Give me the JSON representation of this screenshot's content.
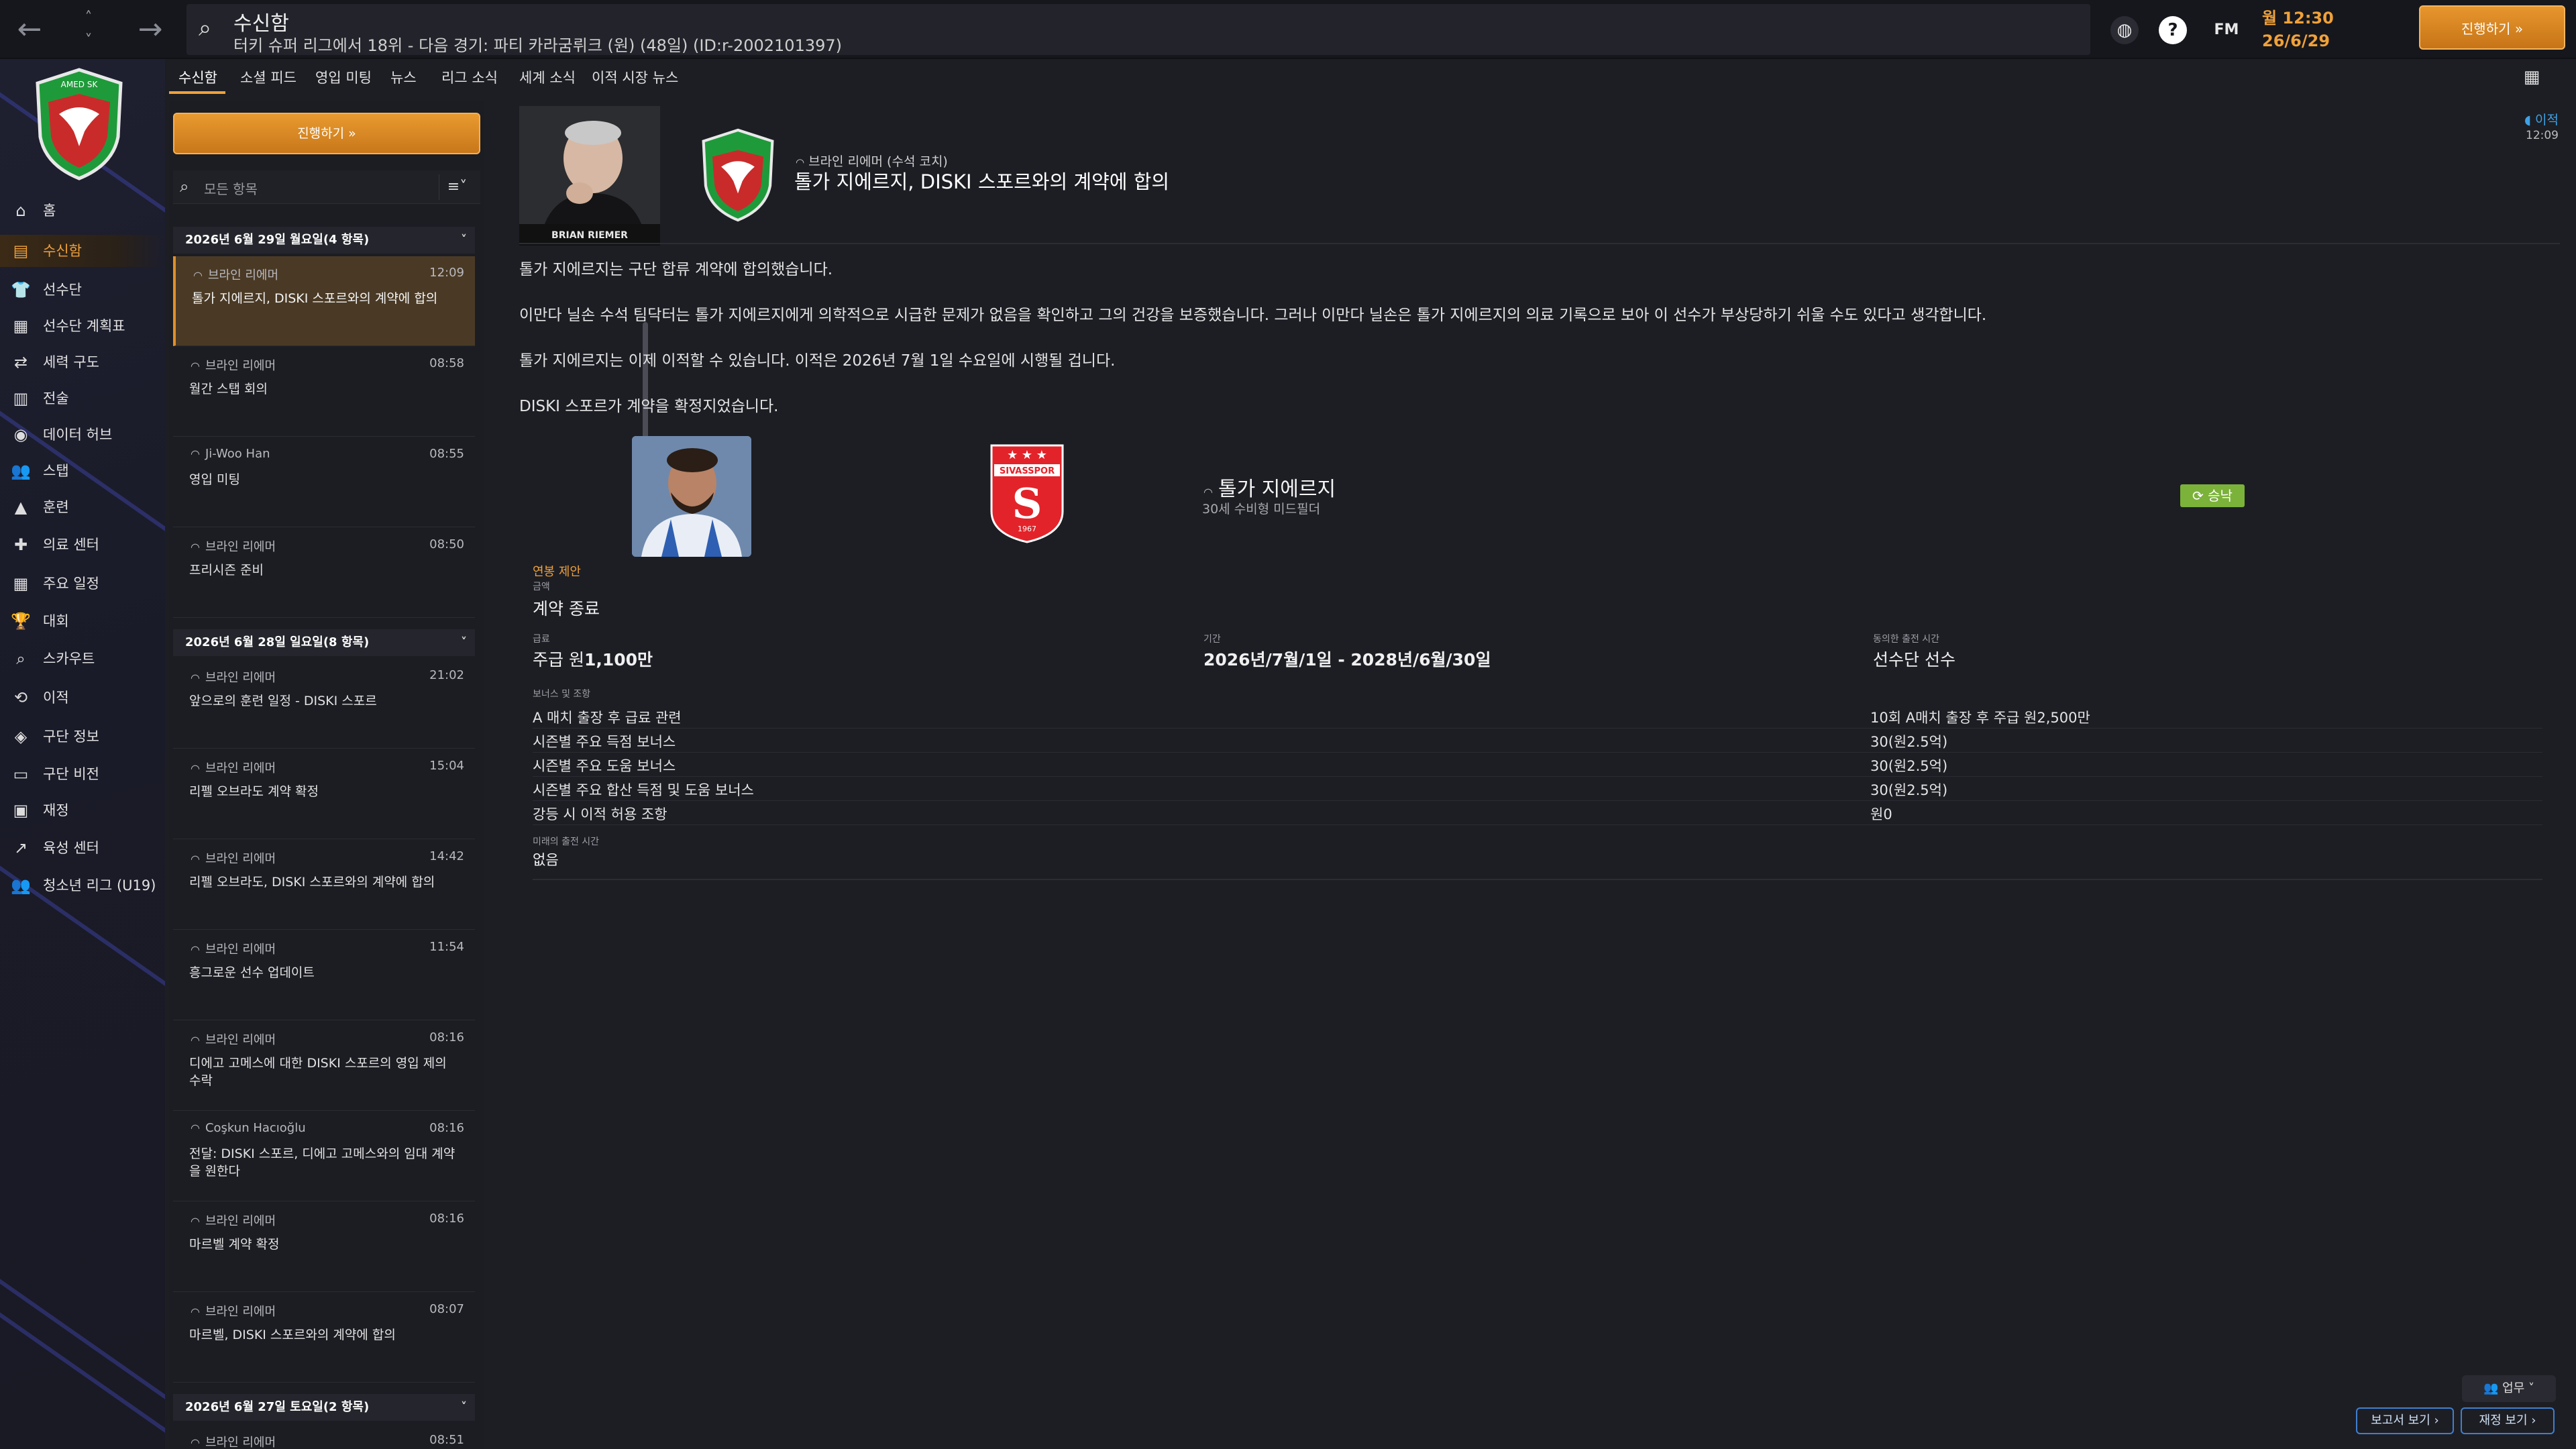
{
  "header": {
    "title": "수신함",
    "subtitle": "터키 슈퍼 리그에서 18위 - 다음 경기: 파티 카라굼뤼크 (원) (48일) (ID:r-2002101397)",
    "time": "월 12:30",
    "date": "26/6/29",
    "continue_label": "진행하기 »",
    "fm_label": "FM",
    "help_label": "?"
  },
  "sidebar": {
    "club_name": "AMED SK",
    "items": [
      {
        "label": "홈",
        "icon": "home-icon",
        "glyph": "⌂"
      },
      {
        "label": "수신함",
        "icon": "inbox-icon",
        "glyph": "▤"
      },
      {
        "label": "선수단",
        "icon": "squad-icon",
        "glyph": "👕"
      },
      {
        "label": "선수단 계획표",
        "icon": "squad-planner-icon",
        "glyph": "▦"
      },
      {
        "label": "세력 구도",
        "icon": "dynamics-icon",
        "glyph": "⇄"
      },
      {
        "label": "전술",
        "icon": "tactics-icon",
        "glyph": "▥"
      },
      {
        "label": "데이터 허브",
        "icon": "data-hub-icon",
        "glyph": "◉"
      },
      {
        "label": "스탭",
        "icon": "staff-icon",
        "glyph": "👥"
      },
      {
        "label": "훈련",
        "icon": "training-icon",
        "glyph": "▲"
      },
      {
        "label": "의료 센터",
        "icon": "medical-icon",
        "glyph": "✚"
      },
      {
        "label": "주요 일정",
        "icon": "schedule-icon",
        "glyph": "▦"
      },
      {
        "label": "대회",
        "icon": "competitions-icon",
        "glyph": "🏆"
      },
      {
        "label": "스카우트",
        "icon": "scouting-icon",
        "glyph": "⌕"
      },
      {
        "label": "이적",
        "icon": "transfers-icon",
        "glyph": "⟲"
      },
      {
        "label": "구단 정보",
        "icon": "club-info-icon",
        "glyph": "◈"
      },
      {
        "label": "구단 비전",
        "icon": "club-vision-icon",
        "glyph": "▭"
      },
      {
        "label": "재정",
        "icon": "finances-icon",
        "glyph": "▣"
      },
      {
        "label": "육성 센터",
        "icon": "development-icon",
        "glyph": "↗"
      },
      {
        "label": "청소년 리그 (U19)",
        "icon": "youth-league-icon",
        "glyph": "👥"
      }
    ]
  },
  "tabs": [
    "수신함",
    "소셜 피드",
    "영입 미팅",
    "뉴스",
    "리그 소식",
    "세계 소식",
    "이적 시장 뉴스"
  ],
  "inbox": {
    "continue_label": "진행하기 »",
    "filter_placeholder": "모든 항목",
    "groups": [
      {
        "header": "2026년 6월 29일 월요일(4 항목)",
        "messages": [
          {
            "from": "브라인 리에머",
            "time": "12:09",
            "subject": "톨가 지에르지, DISKI 스포르와의 계약에 합의",
            "selected": true
          },
          {
            "from": "브라인 리에머",
            "time": "08:58",
            "subject": "월간 스탭 회의"
          },
          {
            "from": "Ji-Woo Han",
            "time": "08:55",
            "subject": "영입 미팅"
          },
          {
            "from": "브라인 리에머",
            "time": "08:50",
            "subject": "프리시즌 준비"
          }
        ]
      },
      {
        "header": "2026년 6월 28일 일요일(8 항목)",
        "messages": [
          {
            "from": "브라인 리에머",
            "time": "21:02",
            "subject": "앞으로의 훈련 일정 - DISKI 스포르"
          },
          {
            "from": "브라인 리에머",
            "time": "15:04",
            "subject": "리펠 오브라도 계약 확정"
          },
          {
            "from": "브라인 리에머",
            "time": "14:42",
            "subject": "리펠 오브라도, DISKI 스포르와의 계약에 합의"
          },
          {
            "from": "브라인 리에머",
            "time": "11:54",
            "subject": "흥그로운 선수 업데이트"
          },
          {
            "from": "브라인 리에머",
            "time": "08:16",
            "subject": "디에고 고메스에 대한 DISKI 스포르의 영입 제의 수락"
          },
          {
            "from": "Coşkun Hacıoğlu",
            "time": "08:16",
            "subject": "전달: DISKI 스포르, 디에고 고메스와의 임대 계약을 원한다"
          },
          {
            "from": "브라인 리에머",
            "time": "08:16",
            "subject": "마르벨 계약 확정"
          },
          {
            "from": "브라인 리에머",
            "time": "08:07",
            "subject": "마르벨, DISKI 스포르와의 계약에 합의"
          }
        ]
      },
      {
        "header": "2026년 6월 27일 토요일(2 항목)",
        "messages": [
          {
            "from": "브라인 리에머",
            "time": "08:51",
            "subject": ""
          }
        ]
      }
    ]
  },
  "detail": {
    "sender_photo_caption": "BRIAN RIEMER",
    "sender_line": "브라인 리에머 (수석 코치)",
    "title": "톨가 지에르지, DISKI 스포르와의 계약에 합의",
    "tag": "이적",
    "time": "12:09",
    "paragraphs": [
      "톨가 지에르지는 구단 합류 계약에 합의했습니다.",
      "이만다 닐손 수석 팀닥터는 톨가 지에르지에게 의학적으로 시급한 문제가 없음을 확인하고 그의 건강을 보증했습니다. 그러나 이만다 닐손은 톨가 지에르지의 의료 기록으로 보아 이 선수가 부상당하기 쉬울 수도 있다고 생각합니다.",
      "톨가 지에르지는 이제 이적할 수 있습니다. 이적은 2026년 7월 1일 수요일에 시행될 겁니다.",
      "DISKI 스포르가 계약을 확정지었습니다."
    ],
    "player_name": "톨가 지에르지",
    "player_desc": "30세 수비형 미드필더",
    "club_crest_text": "SIVASSPOR",
    "club_crest_year": "1967",
    "status": "승낙",
    "offer_label": "연봉 제안",
    "fee_label": "금액",
    "fee_value": "계약 종료",
    "wage_label": "급료",
    "wage_value_prefix": "주급 원",
    "wage_value_amount": "1,100만",
    "period_label": "기간",
    "period_value": "2026년/7월/1일 - 2028년/6월/30일",
    "role_label": "동의한 출전 시간",
    "role_value": "선수단 선수",
    "bonus_label": "보너스 및 조항",
    "bonuses": [
      {
        "label": "A 매치 출장 후 급료 관련",
        "value": "10회 A매치 출장 후 주급 원2,500만"
      },
      {
        "label": "시즌별 주요 득점 보너스",
        "value": "30(원2.5억)"
      },
      {
        "label": "시즌별 주요 도움 보너스",
        "value": "30(원2.5억)"
      },
      {
        "label": "시즌별 주요 합산 득점 및 도움 보너스",
        "value": "30(원2.5억)"
      },
      {
        "label": "강등 시 이적 허용 조항",
        "value": "원0"
      }
    ],
    "future_label": "미래의 출전 시간",
    "future_value": "없음"
  },
  "footer": {
    "work_label": "업무",
    "report_label": "보고서 보기 ›",
    "finance_label": "재정 보기 ›"
  },
  "colors": {
    "accent": "#f0a13a",
    "accepted": "#7bb23a",
    "link": "#3fa2e6"
  }
}
